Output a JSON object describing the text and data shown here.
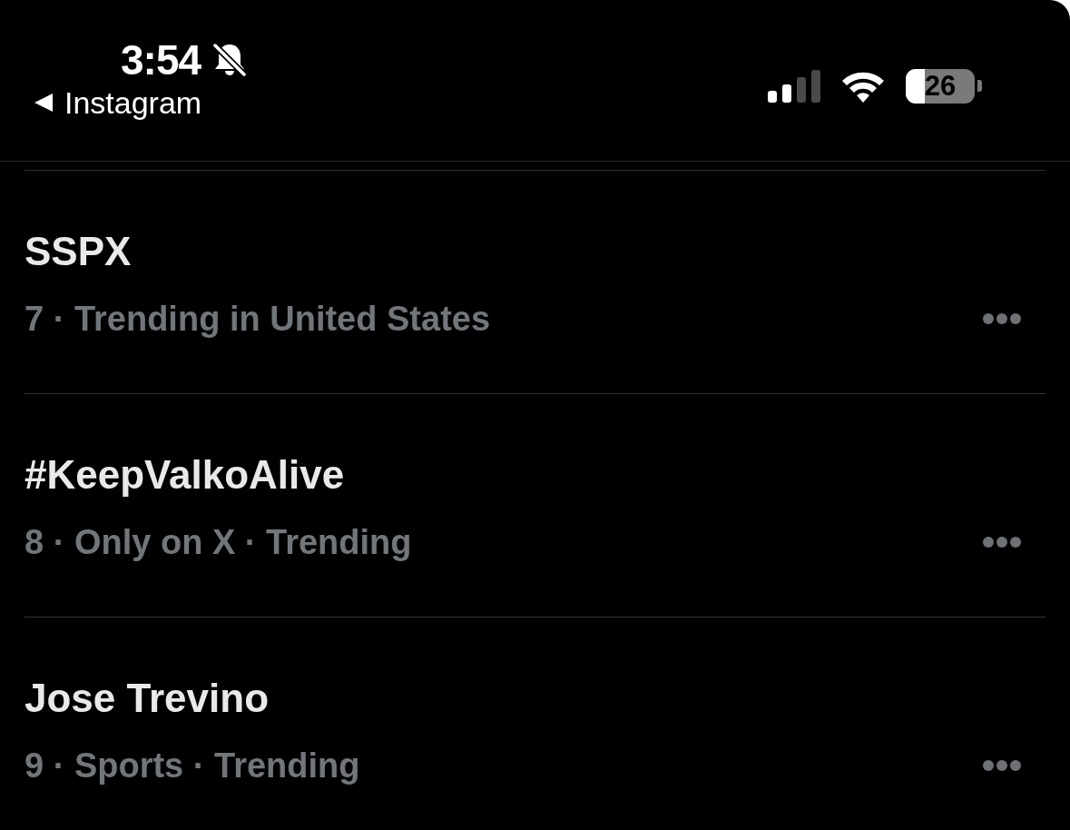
{
  "status_bar": {
    "time": "3:54",
    "silent": true,
    "back_label": "Instagram",
    "battery": "26"
  },
  "trends": [
    {
      "title": "SSPX",
      "meta": "7 · Trending in United States"
    },
    {
      "title": "#KeepValkoAlive",
      "meta": "8 · Only on X · Trending"
    },
    {
      "title": "Jose Trevino",
      "meta": "9 · Sports · Trending"
    }
  ]
}
